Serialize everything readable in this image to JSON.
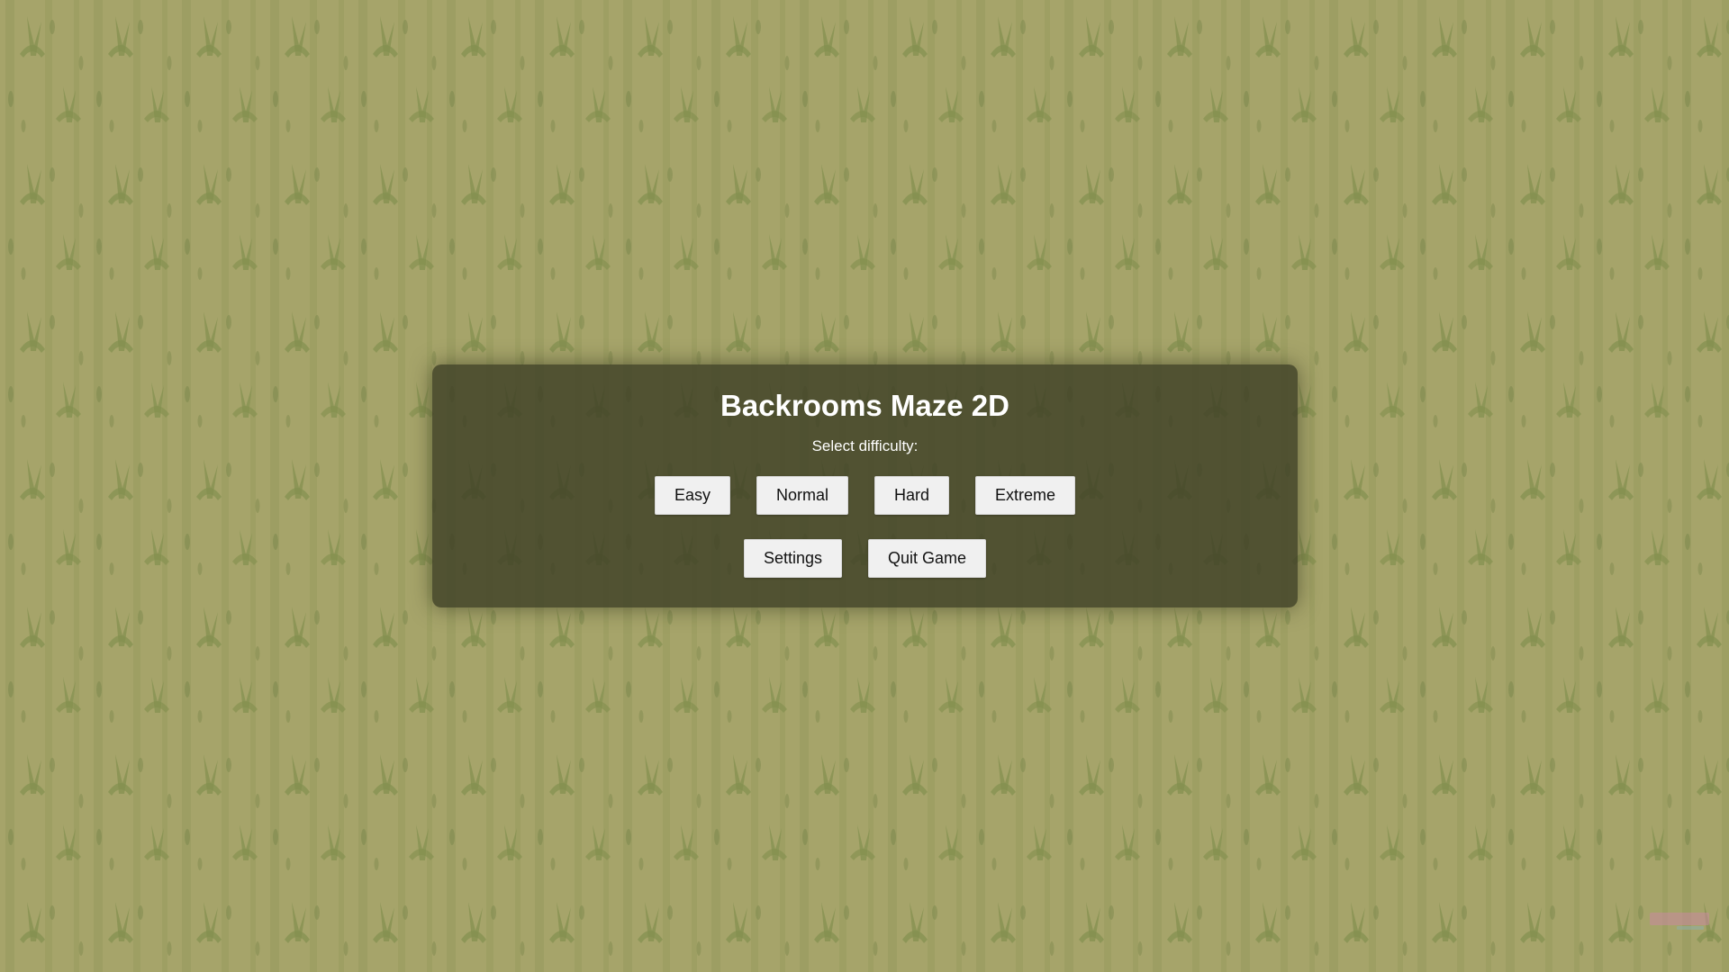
{
  "app": {
    "title": "Backrooms Maze 2D"
  },
  "menu": {
    "title": "Backrooms Maze 2D",
    "subtitle": "Select difficulty:",
    "difficulty_buttons": [
      {
        "label": "Easy"
      },
      {
        "label": "Normal"
      },
      {
        "label": "Hard"
      },
      {
        "label": "Extreme"
      }
    ],
    "settings_label": "Settings",
    "quit_label": "Quit Game"
  },
  "theme": {
    "wallpaper_base": "#a6a46a",
    "wallpaper_pattern": "#7f8a4e",
    "panel_color": "#3e4026",
    "button_color": "#f0f0f0",
    "title_color": "#ffffff"
  },
  "icons": {
    "watermark": "watermark-logo-icon"
  }
}
